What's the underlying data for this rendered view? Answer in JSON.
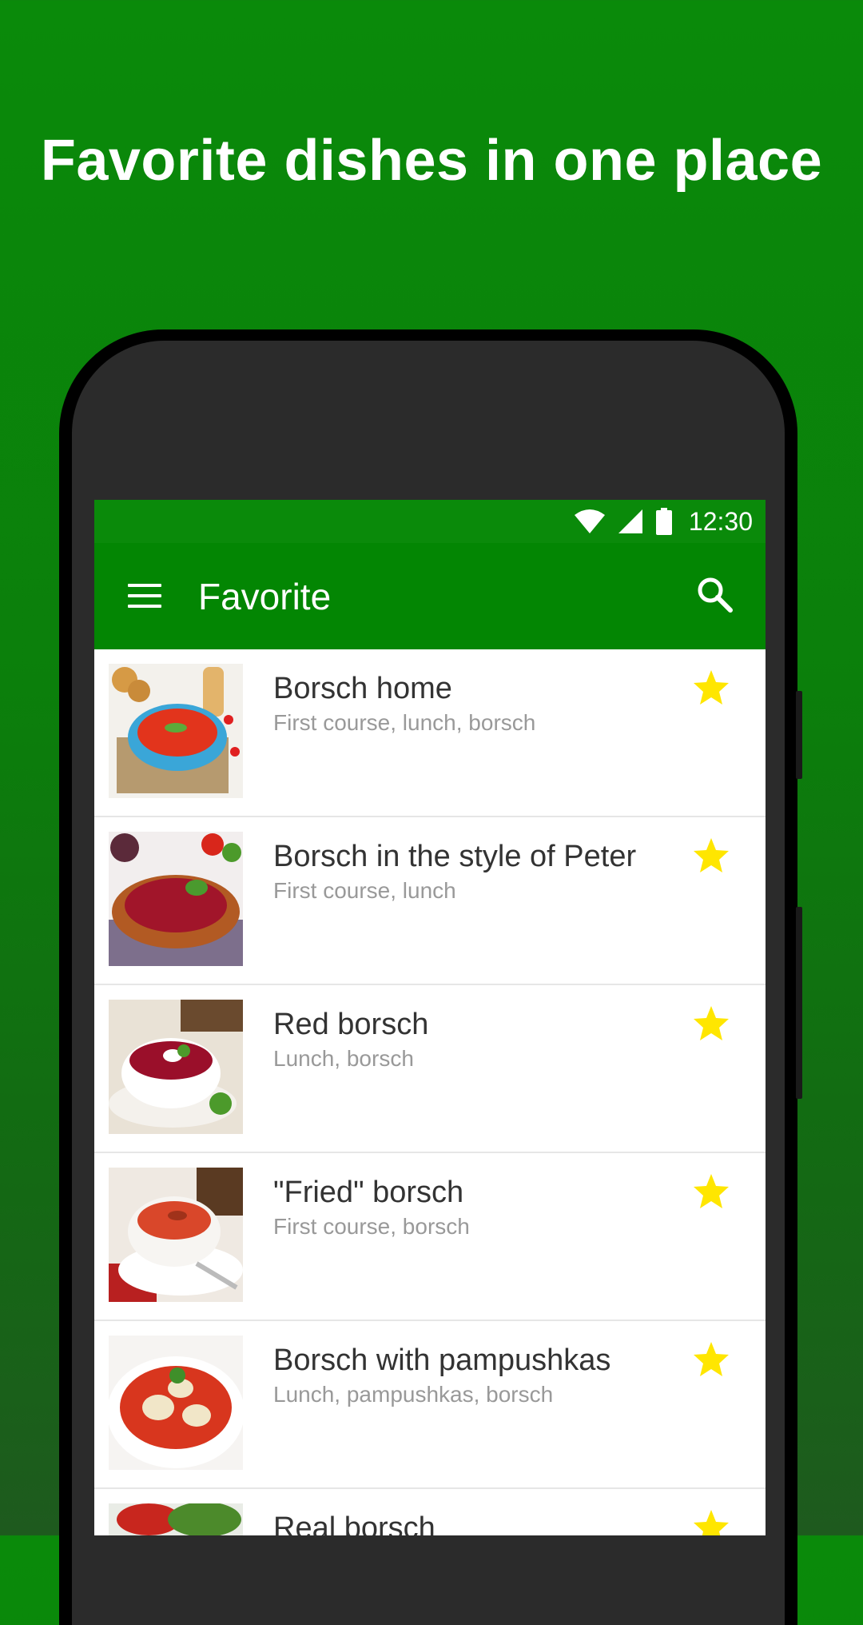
{
  "headline": "Favorite dishes in one place",
  "status": {
    "time": "12:30"
  },
  "appbar": {
    "title": "Favorite"
  },
  "colors": {
    "green_bg": "#0a8a0a",
    "appbar": "#038603",
    "star": "#ffe600"
  },
  "items": [
    {
      "title": "Borsch home",
      "subtitle": "First course, lunch, borsch",
      "favorite": true,
      "image": "soup-blue-bowl"
    },
    {
      "title": "Borsch in the style of Peter",
      "subtitle": "First course, lunch",
      "favorite": true,
      "image": "borsch-clay-pot"
    },
    {
      "title": "Red borsch",
      "subtitle": "Lunch, borsch",
      "favorite": true,
      "image": "borsch-white-bowl"
    },
    {
      "title": "\"Fried\" borsch",
      "subtitle": "First course, borsch",
      "favorite": true,
      "image": "soup-white-cup"
    },
    {
      "title": "Borsch with pampushkas",
      "subtitle": "Lunch, pampushkas, borsch",
      "favorite": true,
      "image": "soup-dumplings"
    },
    {
      "title": "Real borsch",
      "subtitle": "",
      "favorite": true,
      "image": "borsch-herbs"
    }
  ]
}
